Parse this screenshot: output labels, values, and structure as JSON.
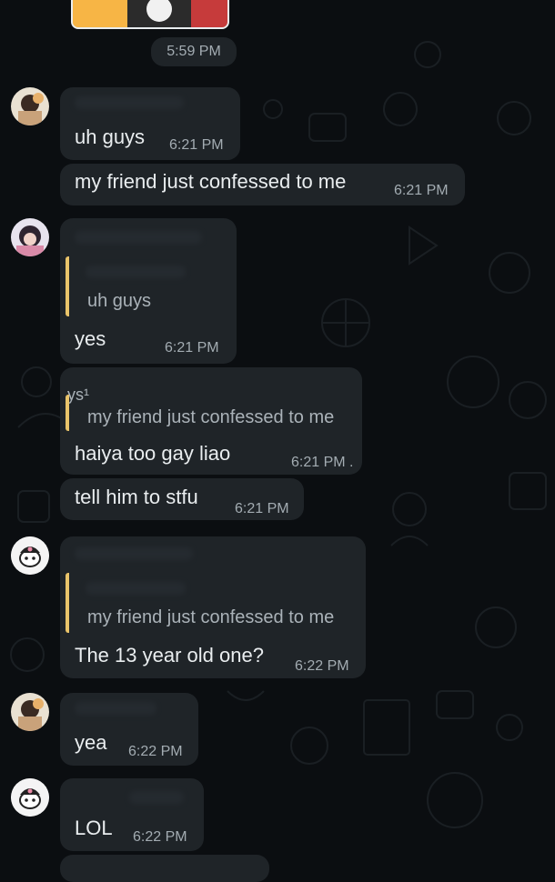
{
  "chat": {
    "top_time": "5:59 PM",
    "messages": [
      {
        "text": "uh guys",
        "time": "6:21 PM"
      },
      {
        "text": "my friend just confessed to me",
        "time": "6:21 PM"
      },
      {
        "quote": "uh guys",
        "text": "yes",
        "time": "6:21 PM"
      },
      {
        "sender_fragment": "ys¹",
        "quote": "my friend just confessed to me",
        "text": "haiya too gay liao",
        "time": "6:21 PM ."
      },
      {
        "text": "tell him to stfu",
        "time": "6:21 PM"
      },
      {
        "quote": "my friend just confessed to me",
        "text": "The 13 year old one?",
        "time": "6:22 PM"
      },
      {
        "text": "yea",
        "time": "6:22 PM"
      },
      {
        "text": "LOL",
        "time": "6:22 PM"
      }
    ]
  },
  "icons": {
    "avatar1": "avatar-icon",
    "avatar2": "avatar-icon",
    "avatar3": "avatar-icon"
  }
}
